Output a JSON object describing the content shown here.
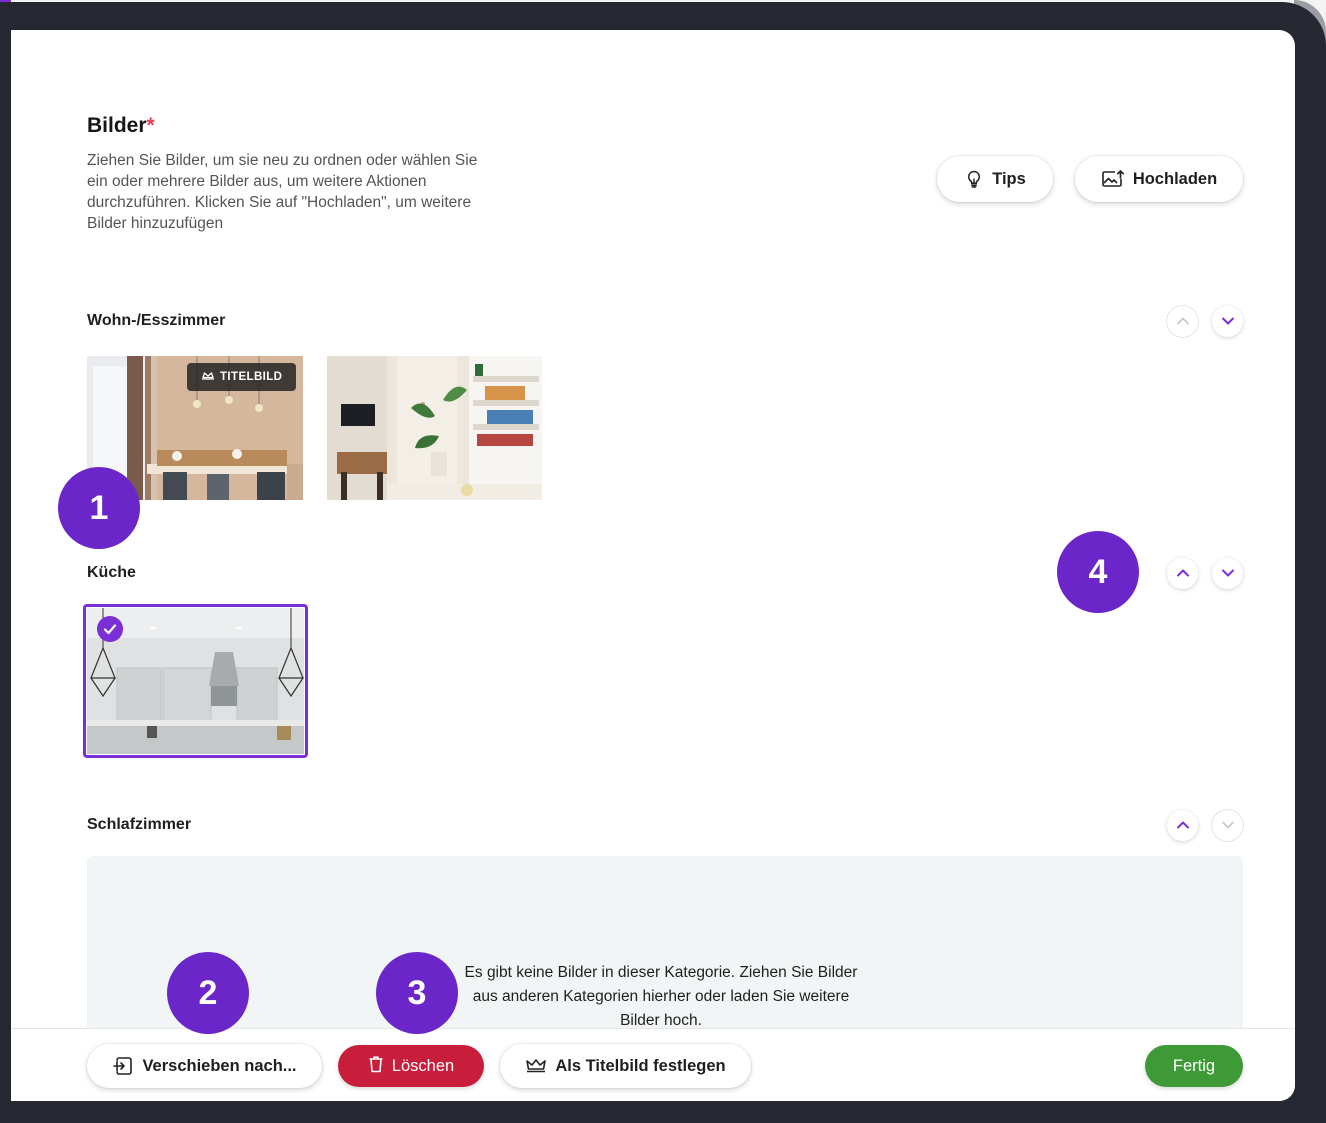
{
  "header": {
    "title": "Bilder",
    "required_mark": "*",
    "description": "Ziehen Sie Bilder, um sie neu zu ordnen oder wählen Sie ein oder mehrere Bilder aus, um weitere Aktionen durchzuführen. Klicken Sie auf \"Hochladen\", um weitere Bilder hinzuzufügen"
  },
  "actions": {
    "tips_label": "Tips",
    "upload_label": "Hochladen"
  },
  "sections": [
    {
      "label": "Wohn-/Esszimmer",
      "photos": [
        "dining-room-photo",
        "living-room-photo"
      ],
      "cover_badge": "TITELBILD"
    },
    {
      "label": "Küche",
      "photos": [
        "kitchen-photo"
      ],
      "selected": true
    },
    {
      "label": "Schlafzimmer",
      "photos": [],
      "empty_text": "Es gibt keine Bilder in dieser Kategorie. Ziehen Sie Bilder aus anderen Kategorien hierher oder laden Sie weitere Bilder hoch."
    }
  ],
  "bottom_bar": {
    "move_label": "Verschieben nach...",
    "delete_label": "Löschen",
    "set_cover_label": "Als Titelbild festlegen",
    "done_label": "Fertig"
  },
  "markers": [
    "1",
    "2",
    "3",
    "4"
  ],
  "colors": {
    "accent": "#7b2fd6",
    "marker": "#6a26c9",
    "delete": "#c81e3c",
    "done": "#3e9a36",
    "required": "#e53f4f"
  },
  "icons": [
    "lightbulb-icon",
    "upload-image-icon",
    "chevron-up-icon",
    "chevron-down-icon",
    "crown-icon",
    "check-icon",
    "move-icon",
    "trash-icon"
  ]
}
